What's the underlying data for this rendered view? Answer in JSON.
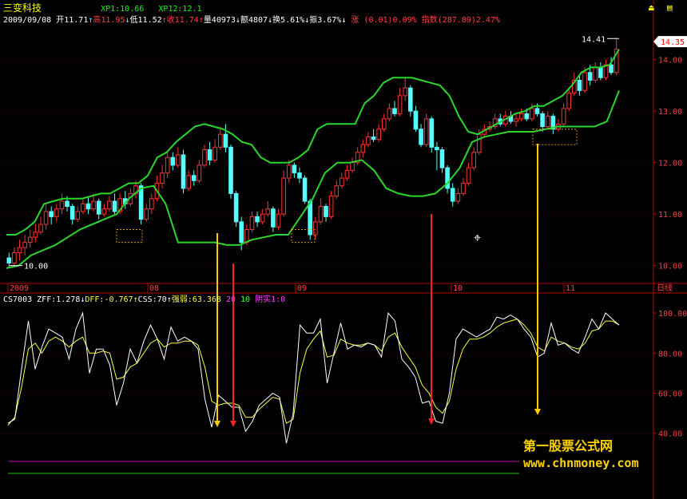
{
  "app": {
    "stock_name": "三变科技",
    "xp1_label": "XP1:10.66",
    "xp12_label": "XP12:12.1"
  },
  "quote": {
    "date": "2009/09/08",
    "open": "开11.71",
    "high": "高11.95",
    "low": "低11.52",
    "close": "收11.74",
    "volume": "量40973",
    "amount": "额4807",
    "turnover": "换5.61%",
    "amplitude": "振3.67%",
    "change_label": "涨",
    "change_value": "(0.01)0.09%",
    "index_label": "指数",
    "index_value": "(287.89)2.47%"
  },
  "indicator": {
    "name": "CS7003",
    "zff": "ZFF:1.278",
    "dff": "DFF:-0.767",
    "css": "CSS:70",
    "strength": "强弱:63.368",
    "n20": "20",
    "n10": "10",
    "yinshi": "阴实1:0"
  },
  "period_label": "日线",
  "price_flag": "14.35",
  "watermark": {
    "line1": "第一股票公式网",
    "line2": "www.chnmoney.com"
  },
  "colors": {
    "background": "#000000",
    "up_candle": "#ff3232",
    "down_candle": "#54ffff",
    "band": "#2bd62b",
    "axis": "#b40000",
    "osc_white": "#ffffff",
    "osc_yellow": "#ffff40",
    "arrow_red": "#ff2020",
    "arrow_yellow": "#ffcc00",
    "ref_purple": "#c000c0",
    "ref_green": "#20c020"
  },
  "chart_data": [
    {
      "type": "candlestick",
      "x_labels": [
        "2009",
        "08",
        "09",
        "10",
        "11"
      ],
      "y_ticks": [
        10.0,
        11.0,
        12.0,
        13.0,
        14.0
      ],
      "ylim": [
        9.7,
        14.6
      ],
      "annotations": [
        {
          "text": "14.41",
          "value": 14.41
        },
        {
          "text": "10.00",
          "value": 10.0
        }
      ],
      "candles": [
        [
          10.15,
          10.05,
          10.25,
          9.95
        ],
        [
          10.05,
          10.25,
          10.35,
          10.0
        ],
        [
          10.25,
          10.35,
          10.5,
          10.1
        ],
        [
          10.35,
          10.45,
          10.6,
          10.2
        ],
        [
          10.45,
          10.55,
          10.7,
          10.35
        ],
        [
          10.55,
          10.65,
          10.8,
          10.45
        ],
        [
          10.65,
          10.8,
          10.95,
          10.6
        ],
        [
          10.8,
          11.05,
          11.2,
          10.7
        ],
        [
          11.05,
          10.95,
          11.15,
          10.8
        ],
        [
          10.95,
          11.1,
          11.2,
          10.85
        ],
        [
          11.1,
          11.25,
          11.4,
          11.0
        ],
        [
          11.25,
          11.15,
          11.35,
          11.05
        ],
        [
          11.15,
          10.9,
          11.2,
          10.8
        ],
        [
          10.9,
          11.05,
          11.15,
          10.85
        ],
        [
          11.05,
          11.2,
          11.3,
          11.0
        ],
        [
          11.2,
          11.1,
          11.35,
          11.0
        ],
        [
          11.1,
          11.25,
          11.4,
          11.05
        ],
        [
          11.25,
          11.0,
          11.3,
          10.9
        ],
        [
          11.0,
          11.1,
          11.2,
          10.95
        ],
        [
          11.1,
          11.25,
          11.35,
          11.05
        ],
        [
          11.25,
          11.05,
          11.4,
          11.0
        ],
        [
          11.05,
          11.3,
          11.4,
          11.0
        ],
        [
          11.3,
          11.2,
          11.45,
          11.1
        ],
        [
          11.2,
          11.4,
          11.5,
          11.15
        ],
        [
          11.4,
          11.55,
          11.65,
          11.3
        ],
        [
          11.55,
          10.9,
          11.6,
          10.8
        ],
        [
          10.9,
          11.1,
          11.2,
          10.85
        ],
        [
          11.1,
          11.3,
          11.4,
          11.0
        ],
        [
          11.3,
          11.6,
          11.75,
          11.25
        ],
        [
          11.6,
          11.8,
          11.95,
          11.5
        ],
        [
          11.8,
          12.1,
          12.2,
          11.7
        ],
        [
          12.1,
          11.95,
          12.2,
          11.85
        ],
        [
          11.95,
          12.15,
          12.3,
          11.9
        ],
        [
          12.15,
          11.5,
          12.25,
          11.4
        ],
        [
          11.5,
          11.75,
          11.85,
          11.45
        ],
        [
          11.75,
          11.65,
          11.85,
          11.55
        ],
        [
          11.65,
          11.95,
          12.05,
          11.6
        ],
        [
          11.95,
          12.25,
          12.35,
          11.9
        ],
        [
          12.25,
          12.05,
          12.4,
          11.95
        ],
        [
          12.05,
          12.3,
          12.45,
          12.0
        ],
        [
          12.3,
          12.55,
          12.7,
          12.25
        ],
        [
          12.55,
          12.3,
          12.75,
          12.2
        ],
        [
          12.3,
          11.4,
          12.35,
          11.3
        ],
        [
          11.4,
          10.85,
          11.45,
          10.75
        ],
        [
          10.85,
          10.45,
          10.95,
          10.3
        ],
        [
          10.45,
          10.7,
          10.8,
          10.4
        ],
        [
          10.7,
          10.95,
          11.05,
          10.65
        ],
        [
          10.95,
          10.85,
          11.05,
          10.75
        ],
        [
          10.85,
          11.0,
          11.1,
          10.8
        ],
        [
          11.0,
          11.1,
          11.25,
          10.95
        ],
        [
          11.1,
          10.75,
          11.15,
          10.65
        ],
        [
          10.75,
          11.0,
          11.1,
          10.7
        ],
        [
          11.0,
          11.7,
          11.85,
          10.95
        ],
        [
          11.7,
          11.95,
          12.05,
          11.6
        ],
        [
          11.95,
          11.8,
          12.0,
          11.7
        ],
        [
          11.8,
          11.7,
          11.9,
          11.6
        ],
        [
          11.7,
          11.25,
          11.75,
          11.2
        ],
        [
          11.25,
          10.6,
          11.3,
          10.5
        ],
        [
          10.6,
          10.85,
          10.95,
          10.5
        ],
        [
          10.85,
          11.15,
          11.3,
          10.8
        ],
        [
          11.15,
          10.95,
          11.2,
          10.85
        ],
        [
          10.95,
          11.35,
          11.45,
          10.9
        ],
        [
          11.35,
          11.55,
          11.65,
          11.3
        ],
        [
          11.55,
          11.7,
          11.8,
          11.5
        ],
        [
          11.7,
          11.85,
          11.95,
          11.65
        ],
        [
          11.85,
          12.0,
          12.1,
          11.8
        ],
        [
          12.0,
          12.2,
          12.3,
          11.95
        ],
        [
          12.2,
          12.35,
          12.45,
          12.1
        ],
        [
          12.35,
          12.5,
          12.6,
          12.3
        ],
        [
          12.5,
          12.45,
          12.65,
          12.4
        ],
        [
          12.45,
          12.65,
          12.75,
          12.4
        ],
        [
          12.65,
          12.85,
          12.95,
          12.6
        ],
        [
          12.85,
          13.05,
          13.15,
          12.8
        ],
        [
          13.05,
          12.95,
          13.2,
          12.9
        ],
        [
          12.95,
          13.3,
          13.45,
          12.9
        ],
        [
          13.3,
          13.45,
          13.65,
          13.2
        ],
        [
          13.45,
          13.0,
          13.5,
          12.9
        ],
        [
          13.0,
          12.65,
          13.1,
          12.6
        ],
        [
          12.65,
          12.35,
          12.75,
          12.3
        ],
        [
          12.35,
          12.85,
          12.95,
          12.3
        ],
        [
          12.85,
          12.3,
          12.9,
          12.2
        ],
        [
          12.3,
          12.25,
          12.4,
          11.85
        ],
        [
          12.25,
          11.9,
          12.3,
          11.8
        ],
        [
          11.9,
          11.5,
          11.95,
          11.4
        ],
        [
          11.5,
          11.25,
          11.6,
          11.15
        ],
        [
          11.25,
          11.4,
          11.5,
          11.2
        ],
        [
          11.4,
          11.6,
          11.7,
          11.35
        ],
        [
          11.6,
          11.9,
          12.0,
          11.55
        ],
        [
          11.9,
          12.2,
          12.3,
          11.85
        ],
        [
          12.2,
          12.55,
          12.65,
          12.15
        ],
        [
          12.55,
          12.65,
          12.75,
          12.5
        ],
        [
          12.65,
          12.7,
          12.8,
          12.6
        ],
        [
          12.7,
          12.85,
          12.95,
          12.65
        ],
        [
          12.85,
          12.75,
          12.95,
          12.7
        ],
        [
          12.75,
          12.9,
          13.0,
          12.7
        ],
        [
          12.9,
          12.8,
          13.0,
          12.75
        ],
        [
          12.8,
          12.85,
          12.95,
          12.7
        ],
        [
          12.85,
          12.95,
          13.05,
          12.8
        ],
        [
          12.95,
          12.85,
          13.05,
          12.8
        ],
        [
          12.85,
          13.05,
          13.15,
          12.8
        ],
        [
          13.05,
          12.95,
          13.15,
          12.9
        ],
        [
          12.95,
          12.7,
          13.0,
          12.6
        ],
        [
          12.7,
          12.9,
          13.0,
          12.65
        ],
        [
          12.9,
          12.65,
          12.95,
          12.55
        ],
        [
          12.65,
          12.75,
          12.85,
          12.6
        ],
        [
          12.75,
          13.05,
          13.15,
          12.7
        ],
        [
          13.05,
          13.35,
          13.45,
          13.0
        ],
        [
          13.35,
          13.6,
          13.75,
          13.3
        ],
        [
          13.6,
          13.4,
          13.7,
          13.3
        ],
        [
          13.4,
          13.75,
          13.85,
          13.35
        ],
        [
          13.75,
          13.6,
          13.9,
          13.5
        ],
        [
          13.6,
          13.85,
          13.95,
          13.55
        ],
        [
          13.85,
          13.65,
          13.95,
          13.6
        ],
        [
          13.65,
          13.9,
          14.0,
          13.6
        ],
        [
          13.9,
          13.75,
          14.05,
          13.7
        ],
        [
          13.75,
          14.2,
          14.41,
          13.7
        ]
      ],
      "upper_band": [
        10.6,
        10.6,
        10.7,
        10.85,
        11.2,
        11.25,
        11.3,
        11.3,
        11.3,
        11.35,
        11.4,
        11.4,
        11.5,
        11.6,
        11.6,
        11.75,
        12.1,
        12.2,
        12.4,
        12.55,
        12.7,
        12.75,
        12.7,
        12.65,
        12.55,
        12.4,
        12.35,
        12.1,
        12.0,
        12.0,
        12.0,
        12.1,
        12.25,
        12.65,
        12.75,
        12.75,
        12.75,
        12.75,
        13.15,
        13.3,
        13.55,
        13.65,
        13.65,
        13.65,
        13.6,
        13.55,
        13.5,
        13.3,
        12.9,
        12.6,
        12.55,
        12.65,
        12.75,
        12.85,
        12.95,
        13.0,
        13.1,
        13.1,
        13.2,
        13.3,
        13.5,
        13.75,
        13.85,
        13.85,
        13.9,
        14.2
      ],
      "lower_band": [
        9.95,
        10.0,
        10.2,
        10.3,
        10.4,
        10.55,
        10.7,
        10.8,
        10.9,
        11.0,
        11.3,
        11.5,
        11.55,
        11.2,
        10.45,
        10.45,
        10.45,
        10.45,
        10.4,
        10.4,
        10.5,
        10.55,
        10.6,
        10.6,
        10.95,
        11.3,
        11.8,
        12.0,
        12.0,
        12.05,
        11.85,
        11.5,
        11.4,
        11.35,
        11.35,
        11.4,
        11.6,
        11.9,
        12.4,
        12.5,
        12.55,
        12.6,
        12.6,
        12.6,
        12.65,
        12.7,
        12.7,
        12.7,
        12.7,
        12.8,
        13.4
      ],
      "dashed_boxes": [
        {
          "from": 10.45,
          "to": 10.7
        },
        {
          "from": 10.45,
          "to": 10.7
        },
        {
          "from": 12.35,
          "to": 12.65
        }
      ]
    },
    {
      "type": "line",
      "title": "CS7003",
      "y_ticks": [
        40.0,
        60.0,
        80.0,
        100.0
      ],
      "ylim": [
        10,
        104
      ],
      "series": [
        {
          "name": "white",
          "values": [
            45,
            47,
            72,
            96,
            72,
            83,
            92,
            90,
            88,
            77,
            92,
            100,
            70,
            82,
            82,
            74,
            54,
            65,
            82,
            75,
            86,
            94,
            87,
            77,
            93,
            86,
            88,
            86,
            82,
            57,
            43,
            59,
            56,
            53,
            53,
            41,
            46,
            54,
            57,
            60,
            58,
            35,
            50,
            94,
            90,
            90,
            97,
            65,
            80,
            95,
            82,
            84,
            83,
            85,
            84,
            78,
            100,
            96,
            77,
            73,
            68,
            55,
            56,
            46,
            45,
            60,
            87,
            92,
            90,
            88,
            90,
            92,
            98,
            97,
            99,
            97,
            92,
            88,
            78,
            80,
            95,
            84,
            85,
            82,
            80,
            88,
            97,
            92,
            100,
            97,
            94
          ]
        },
        {
          "name": "yellow",
          "values": [
            44,
            48,
            63,
            82,
            85,
            80,
            86,
            88,
            86,
            83,
            86,
            88,
            80,
            80,
            81,
            80,
            67,
            68,
            73,
            75,
            80,
            85,
            87,
            83,
            85,
            85,
            86,
            86,
            84,
            73,
            56,
            54,
            55,
            55,
            54,
            48,
            48,
            52,
            55,
            58,
            57,
            45,
            47,
            70,
            82,
            87,
            91,
            78,
            79,
            87,
            85,
            84,
            84,
            85,
            84,
            81,
            88,
            90,
            83,
            78,
            73,
            64,
            60,
            53,
            50,
            56,
            72,
            82,
            87,
            87,
            88,
            90,
            93,
            95,
            96,
            97,
            94,
            90,
            83,
            81,
            88,
            86,
            85,
            83,
            82,
            85,
            91,
            92,
            96,
            96,
            94
          ]
        }
      ],
      "reference_lines": [
        26,
        20
      ]
    }
  ]
}
